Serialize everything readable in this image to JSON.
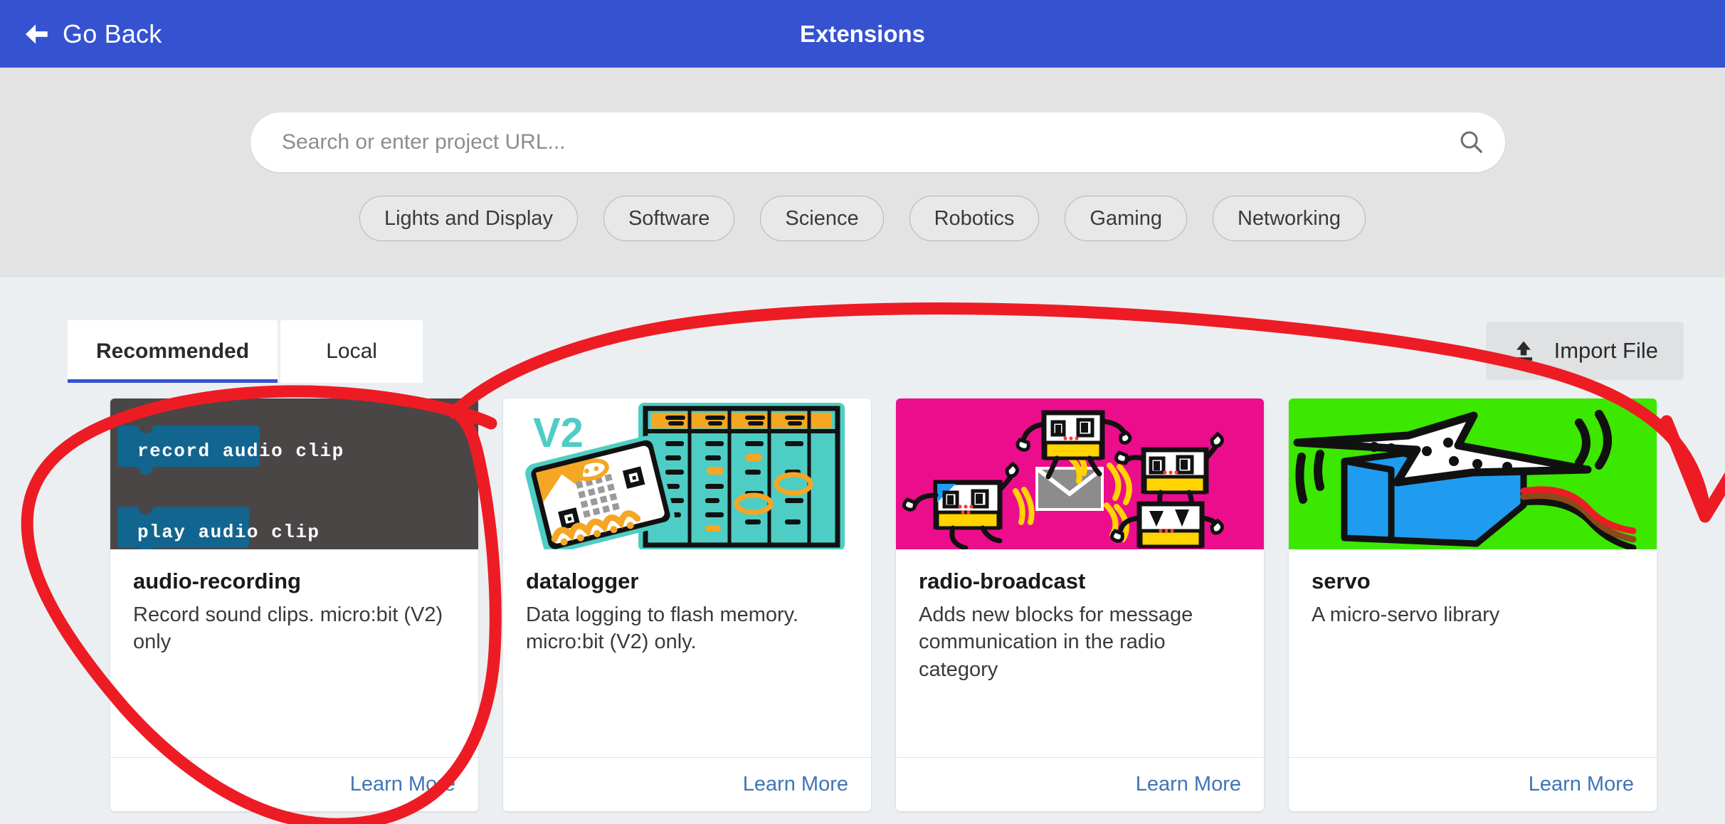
{
  "header": {
    "back_label": "Go Back",
    "title": "Extensions",
    "accent_color": "#3552d0",
    "back_icon": "arrow-left-icon"
  },
  "search": {
    "placeholder": "Search or enter project URL...",
    "value": "",
    "icon": "search-icon"
  },
  "categories": [
    {
      "label": "Lights and Display"
    },
    {
      "label": "Software"
    },
    {
      "label": "Science"
    },
    {
      "label": "Robotics"
    },
    {
      "label": "Gaming"
    },
    {
      "label": "Networking"
    }
  ],
  "tabs": [
    {
      "label": "Recommended",
      "active": true
    },
    {
      "label": "Local",
      "active": false
    }
  ],
  "toolbar": {
    "import_label": "Import File",
    "import_icon": "upload-icon"
  },
  "cards": [
    {
      "title": "audio-recording",
      "description": "Record sound clips. micro:bit (V2) only",
      "link_label": "Learn More",
      "thumbnail": {
        "kind": "code-blocks",
        "background": "#4a4646",
        "block_color": "#11658f",
        "blocks": [
          "record audio clip",
          "play audio clip"
        ]
      }
    },
    {
      "title": "datalogger",
      "description": "Data logging to flash memory. micro:bit (V2) only.",
      "link_label": "Learn More",
      "thumbnail": {
        "kind": "illustration-datalogger",
        "background": "#ffffff",
        "badge_text": "V2",
        "teal": "#4ecdc4",
        "orange": "#f5a623"
      }
    },
    {
      "title": "radio-broadcast",
      "description": "Adds new blocks for message communication in the radio category",
      "link_label": "Learn More",
      "thumbnail": {
        "kind": "illustration-radio",
        "background": "#ec0d8c",
        "yellow": "#ffd400",
        "envelope": "#8c8c8c"
      }
    },
    {
      "title": "servo",
      "description": "A micro-servo library",
      "link_label": "Learn More",
      "thumbnail": {
        "kind": "illustration-servo",
        "background": "#3ce800",
        "body": "#1f9cf0",
        "horn": "#ffffff"
      }
    }
  ],
  "annotation": {
    "color": "#ed1c24",
    "shapes": [
      {
        "name": "circle-around-audio-recording-card"
      },
      {
        "name": "arrow-to-import-file-button"
      }
    ]
  }
}
